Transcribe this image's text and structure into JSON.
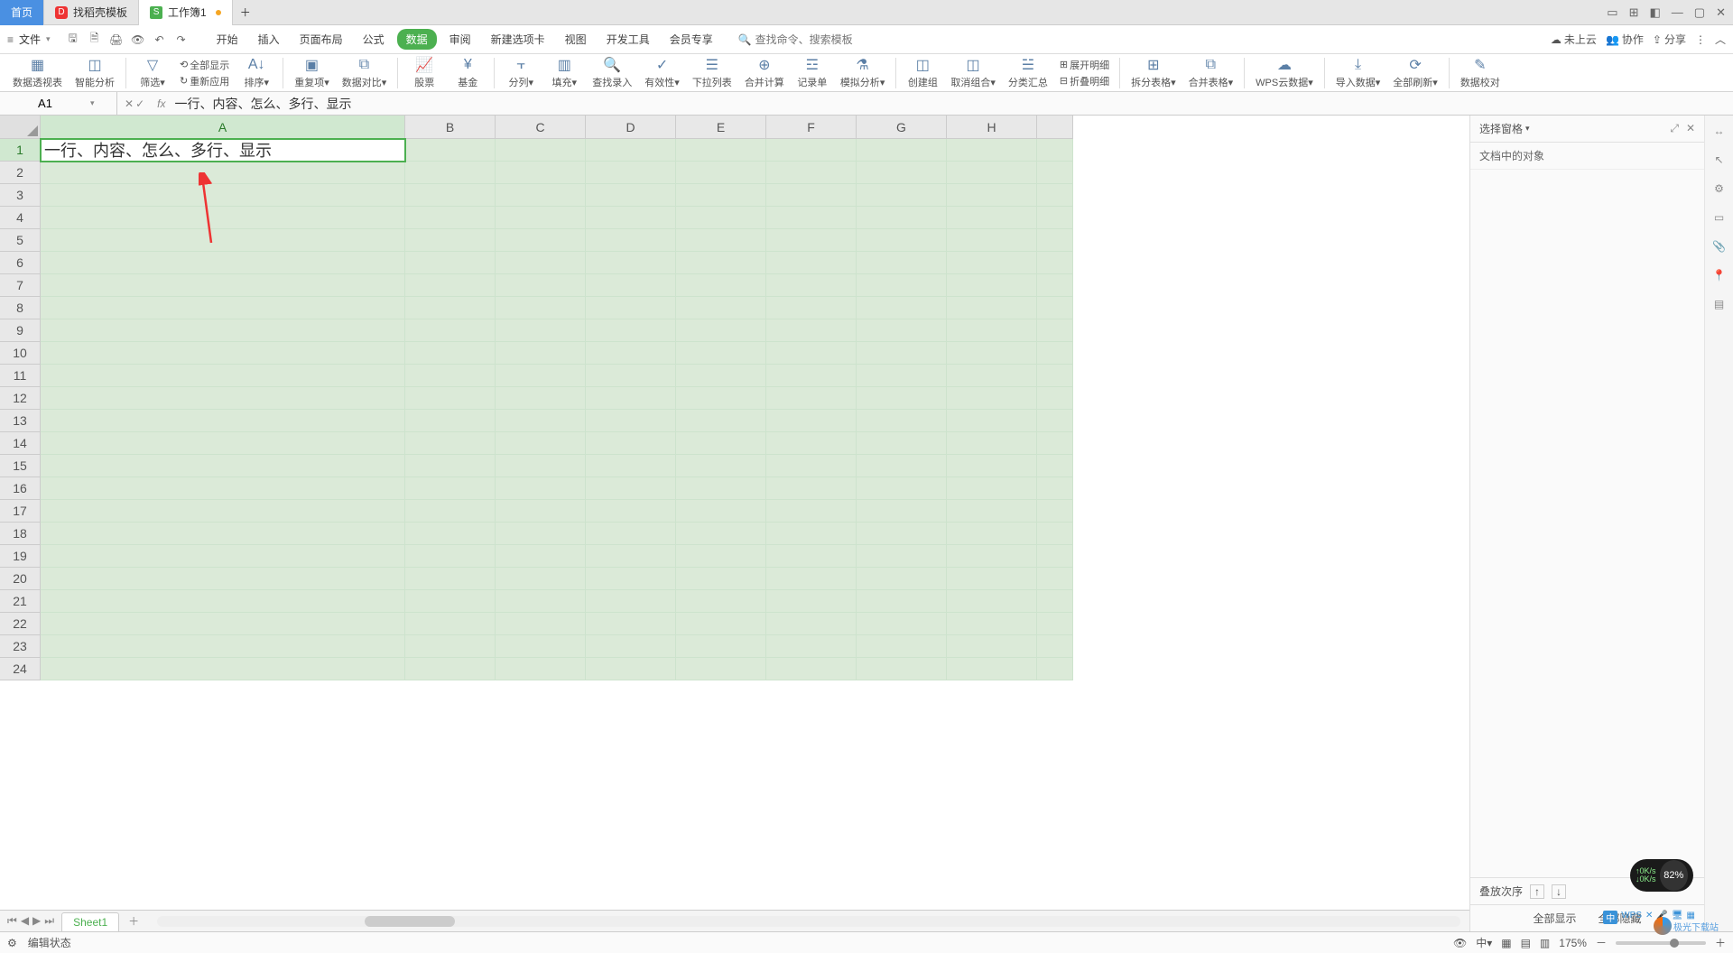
{
  "tabs": {
    "home": "首页",
    "t1": "找稻壳模板",
    "t2": "工作簿1"
  },
  "menu": {
    "file": "文件",
    "items": [
      "开始",
      "插入",
      "页面布局",
      "公式",
      "数据",
      "审阅",
      "新建选项卡",
      "视图",
      "开发工具",
      "会员专享"
    ],
    "active_index": 4,
    "search_placeholder": "查找命令、搜索模板"
  },
  "menu_right": {
    "cloud": "未上云",
    "collab": "协作",
    "share": "分享"
  },
  "ribbon": {
    "pivot": "数据透视表",
    "smart": "智能分析",
    "filter": "筛选",
    "showall": "全部显示",
    "reapply": "重新应用",
    "sort": "排序",
    "dup": "重复项",
    "compare": "数据对比",
    "stock": "股票",
    "fund": "基金",
    "split": "分列",
    "fill": "填充",
    "lookup": "查找录入",
    "valid": "有效性",
    "dropdown": "下拉列表",
    "consol": "合并计算",
    "record": "记录单",
    "simul": "模拟分析",
    "group": "创建组",
    "ungroup": "取消组合",
    "subtotal": "分类汇总",
    "expand": "展开明细",
    "collapse": "折叠明细",
    "splittbl": "拆分表格",
    "mergetbl": "合并表格",
    "cloud": "WPS云数据",
    "import": "导入数据",
    "refresh": "全部刷新",
    "datav": "数据校对"
  },
  "cell_ref": "A1",
  "cell_content": "一行、内容、怎么、多行、显示",
  "columns": [
    "A",
    "B",
    "C",
    "D",
    "E",
    "F",
    "G",
    "H"
  ],
  "rows": [
    "1",
    "2",
    "3",
    "4",
    "5",
    "6",
    "7",
    "8",
    "9",
    "10",
    "11",
    "12",
    "13",
    "14",
    "15",
    "16",
    "17",
    "18",
    "19",
    "20",
    "21",
    "22",
    "23",
    "24"
  ],
  "rpanel": {
    "title": "选择窗格",
    "subtitle": "文档中的对象",
    "stack": "叠放次序",
    "showall": "全部显示",
    "hideall": "全部隐藏"
  },
  "sheet": {
    "tab": "Sheet1"
  },
  "status": {
    "mode": "编辑状态",
    "zoom": "175%"
  },
  "widget": {
    "up": "0K/s",
    "down": "0K/s",
    "pct": "82%"
  },
  "logo": "极光下载站",
  "tray": "中"
}
